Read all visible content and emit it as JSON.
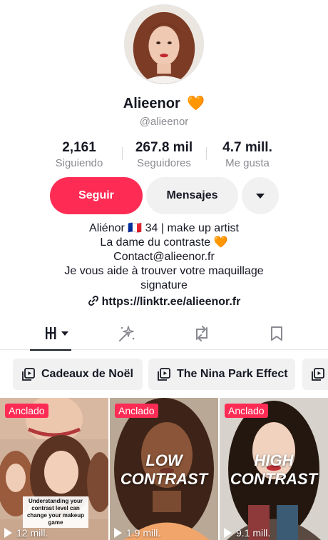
{
  "profile": {
    "display_name": "Alieenor",
    "name_emoji": "🧡",
    "handle": "@alieenor"
  },
  "stats": [
    {
      "value": "2,161",
      "label": "Siguiendo"
    },
    {
      "value": "267.8 mil",
      "label": "Seguidores"
    },
    {
      "value": "4.7 mill.",
      "label": "Me gusta"
    }
  ],
  "actions": {
    "follow_label": "Seguir",
    "message_label": "Mensajes",
    "more_icon": "triangle-down-icon"
  },
  "bio": {
    "lines": [
      "Aliénor 🇫🇷 34 | make up artist",
      "La dame du contraste 🧡",
      "Contact@alieenor.fr",
      "Je vous aide à trouver votre maquillage",
      "signature"
    ],
    "link": "https://linktr.ee/alieenor.fr"
  },
  "tabs": [
    {
      "icon": "grid-icon",
      "active": true
    },
    {
      "icon": "sparkle-icon",
      "active": false
    },
    {
      "icon": "repost-icon",
      "active": false
    },
    {
      "icon": "bookmark-icon",
      "active": false
    }
  ],
  "playlists": [
    {
      "label": "Cadeaux de Noël"
    },
    {
      "label": "The Nina Park Effect"
    },
    {
      "label": ""
    }
  ],
  "videos": [
    {
      "pinned_label": "Anclado",
      "views": "12 mill.",
      "caption": "Understanding your contrast level can change your makeup game",
      "overlay_title": ""
    },
    {
      "pinned_label": "Anclado",
      "views": "1.9 mill.",
      "caption": "",
      "overlay_title": "LOW CONTRAST"
    },
    {
      "pinned_label": "Anclado",
      "views": "9.1 mill.",
      "caption": "",
      "overlay_title": "HIGH CONTRAST"
    }
  ],
  "colors": {
    "accent": "#fe2c55",
    "text": "#161823",
    "muted": "#8a8b91",
    "button_bg": "#f1f1f2"
  }
}
